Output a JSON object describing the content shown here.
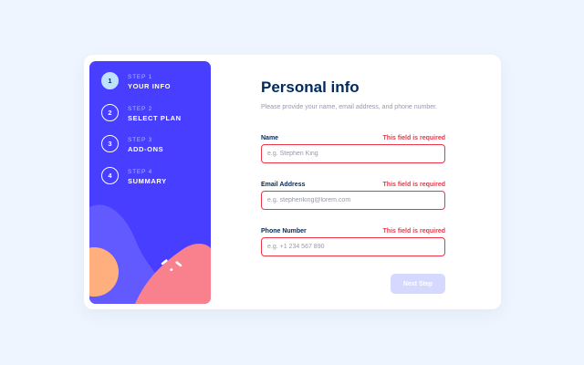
{
  "steps": [
    {
      "number": "1",
      "kicker": "STEP 1",
      "title": "YOUR INFO",
      "active": true
    },
    {
      "number": "2",
      "kicker": "STEP 2",
      "title": "SELECT PLAN",
      "active": false
    },
    {
      "number": "3",
      "kicker": "STEP 3",
      "title": "ADD-ONS",
      "active": false
    },
    {
      "number": "4",
      "kicker": "STEP 4",
      "title": "SUMMARY",
      "active": false
    }
  ],
  "form": {
    "title": "Personal info",
    "subtitle": "Please provide your name, email address, and phone number.",
    "fields": [
      {
        "label": "Name",
        "error": "This field is required",
        "value": "",
        "placeholder": "e.g. Stephen King"
      },
      {
        "label": "Email Address",
        "error": "This field is required",
        "value": "",
        "placeholder": "e.g. stephenking@lorem.com"
      },
      {
        "label": "Phone Number",
        "error": "This field is required",
        "value": "",
        "placeholder": "e.g. +1 234 567 890"
      }
    ],
    "next_label": "Next Step"
  },
  "colors": {
    "sidebar": "#483eff",
    "active_step": "#bee2fd",
    "heading": "#02295a",
    "error": "#ed3548",
    "button_disabled": "#d6d9ff",
    "shape_orange": "#ffaf7e",
    "shape_pink": "#f9818e",
    "shape_violet": "#6259ff"
  },
  "icons": {
    "sidebar_decor": "sidebar-background-shapes"
  }
}
